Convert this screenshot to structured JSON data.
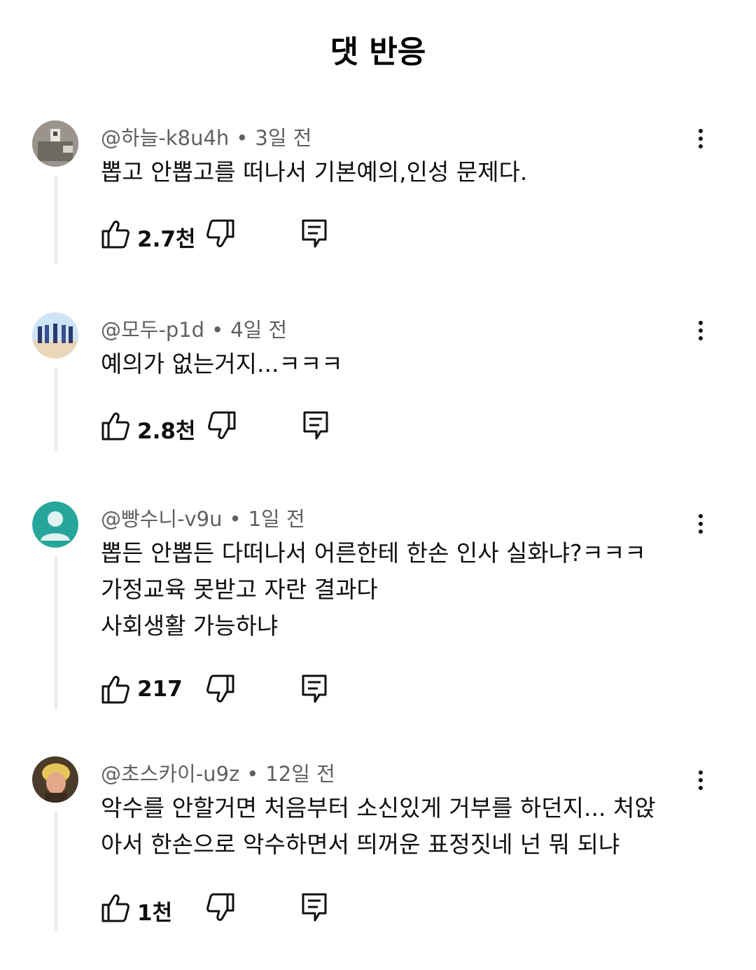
{
  "title": "댓 반응",
  "comments": [
    {
      "author": "@하늘-k8u4h",
      "time": "3일 전",
      "text": "뽑고 안뽑고를 떠나서 기본예의,인성 문제다.",
      "likes": "2.7천"
    },
    {
      "author": "@모두-p1d",
      "time": "4일 전",
      "text": "예의가 없는거지...ㅋㅋㅋ",
      "likes": "2.8천"
    },
    {
      "author": "@빵수니-v9u",
      "time": "1일 전",
      "text": "뽑든 안뽑든 다떠나서 어른한테 한손 인사 실화냐?ㅋㅋㅋ\n가정교육 못받고 자란 결과다\n사회생활 가능하냐",
      "likes": "217"
    },
    {
      "author": "@초스카이-u9z",
      "time": "12일 전",
      "text": "악수를 안할거면 처음부터 소신있게 거부를 하던지... 처앉\n아서 한손으로 악수하면서 띄꺼운 표정짓네 넌 뭐 되냐",
      "likes": "1천"
    }
  ],
  "separator": "•"
}
